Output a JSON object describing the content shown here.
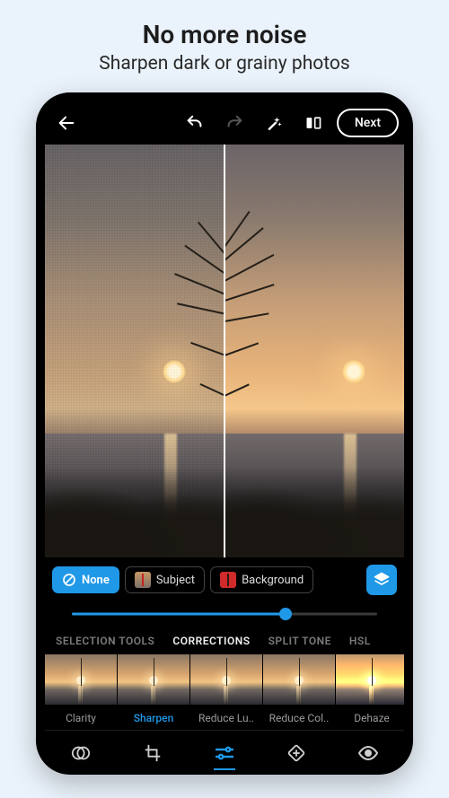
{
  "promo": {
    "title": "No more noise",
    "subtitle": "Sharpen dark or grainy photos"
  },
  "topbar": {
    "next_label": "Next"
  },
  "mask": {
    "none_label": "None",
    "subject_label": "Subject",
    "background_label": "Background"
  },
  "slider": {
    "value_percent": 70
  },
  "tabs": {
    "items": [
      "SELECTION TOOLS",
      "CORRECTIONS",
      "SPLIT TONE",
      "HSL"
    ],
    "active_index": 1
  },
  "corrections": {
    "items": [
      {
        "label": "Clarity"
      },
      {
        "label": "Sharpen"
      },
      {
        "label": "Reduce Lu.."
      },
      {
        "label": "Reduce Col.."
      },
      {
        "label": "Dehaze"
      }
    ],
    "active_index": 1
  },
  "bottomnav": {
    "items": [
      "looks",
      "crop",
      "adjust",
      "heal",
      "redeye"
    ],
    "active_index": 2
  },
  "colors": {
    "accent": "#2098e8"
  }
}
